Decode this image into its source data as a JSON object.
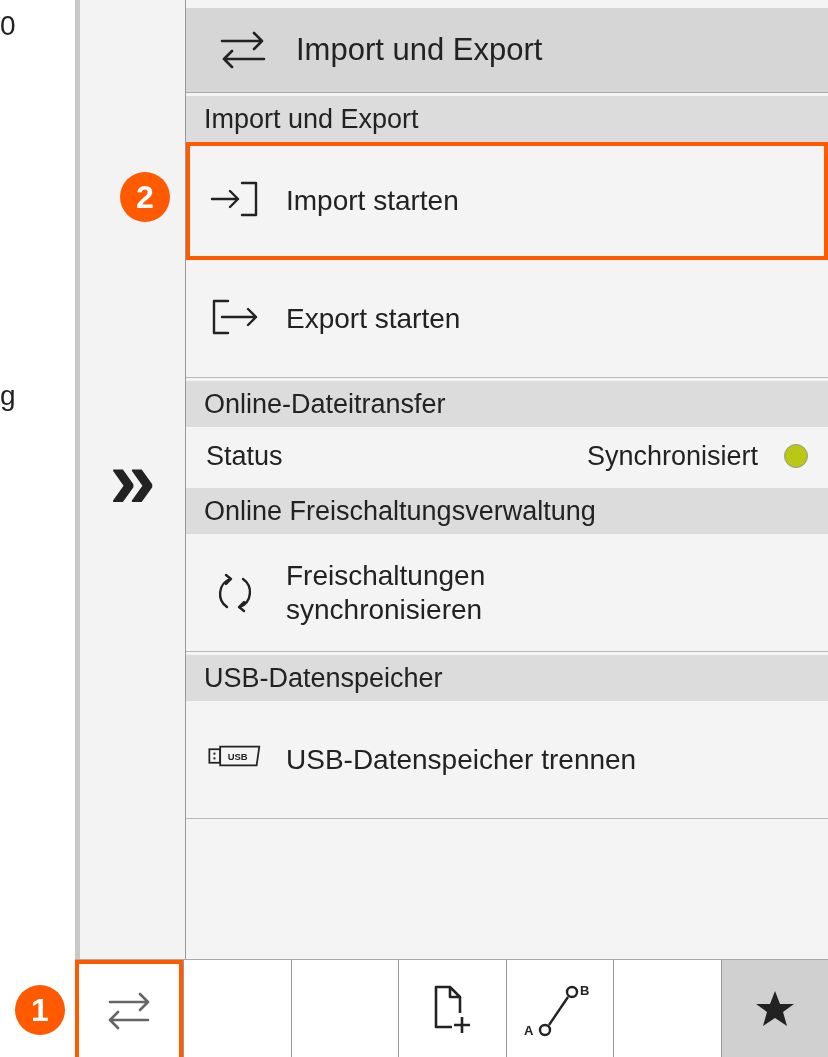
{
  "background_fragments": [
    "0",
    "g"
  ],
  "side_column": {
    "expand_glyph": "»"
  },
  "panel": {
    "title": "Import und Export",
    "sections": [
      {
        "header": "Import und Export",
        "items": [
          {
            "kind": "action",
            "label": "Import starten",
            "highlighted": true,
            "badge": "2"
          },
          {
            "kind": "action",
            "label": "Export starten",
            "highlighted": false
          }
        ]
      },
      {
        "header": "Online-Dateitransfer",
        "items": [
          {
            "kind": "status",
            "label": "Status",
            "value": "Synchronisiert",
            "color": "#b8c814"
          }
        ]
      },
      {
        "header": "Online Freischaltungsverwaltung",
        "items": [
          {
            "kind": "action",
            "label": "Freischaltungen\nsynchronisieren",
            "highlighted": false
          }
        ]
      },
      {
        "header": "USB-Datenspeicher",
        "items": [
          {
            "kind": "action",
            "label": "USB-Datenspeicher trennen",
            "highlighted": false,
            "icon_text": "USB"
          }
        ]
      }
    ]
  },
  "toolbar": {
    "badge": "1",
    "buttons": [
      {
        "highlighted": true,
        "selected": false
      },
      {
        "highlighted": false,
        "selected": false
      },
      {
        "highlighted": false,
        "selected": false
      },
      {
        "highlighted": false,
        "selected": false
      },
      {
        "highlighted": false,
        "selected": false,
        "icon_text": [
          "A",
          "B"
        ]
      },
      {
        "highlighted": false,
        "selected": false
      },
      {
        "highlighted": false,
        "selected": true
      }
    ]
  }
}
